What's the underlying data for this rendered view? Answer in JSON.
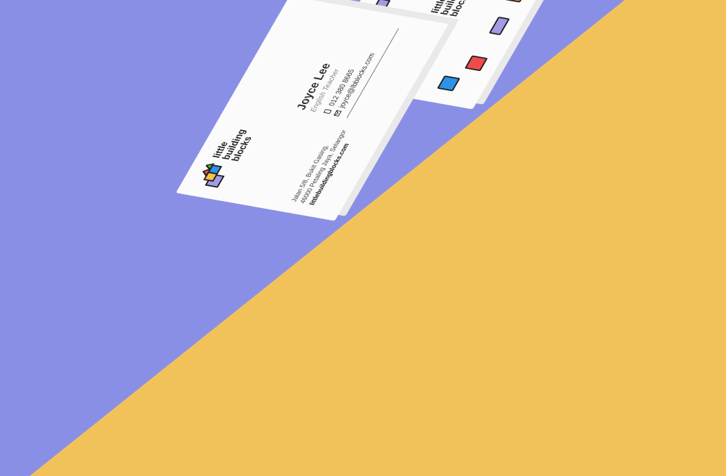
{
  "scene": {
    "colors": {
      "background_left": "#8a8fe6",
      "background_right": "#f2c25a",
      "card": "#fbfbfb",
      "red": "#ef4b4b",
      "blue": "#2d93e6",
      "yellow": "#f5c34a",
      "green": "#3ebd55",
      "purple": "#a39be6",
      "orange": "#f4844a"
    }
  },
  "front_card": {
    "logo_lines": [
      "little",
      "building",
      "blocks"
    ],
    "name": "Joyce Lee",
    "role": "English Teacher",
    "phone": "012 380 8665",
    "email": "joyce@lbblocks.com",
    "address_line1": "Jalan 5/8, Bukit Gasing,",
    "address_line2": "46000 Petaling Jaya, Selangor",
    "website": "littlebuildingblocks.com"
  },
  "back_card": {
    "logo_lines": [
      "little",
      "building",
      "blocks"
    ]
  }
}
